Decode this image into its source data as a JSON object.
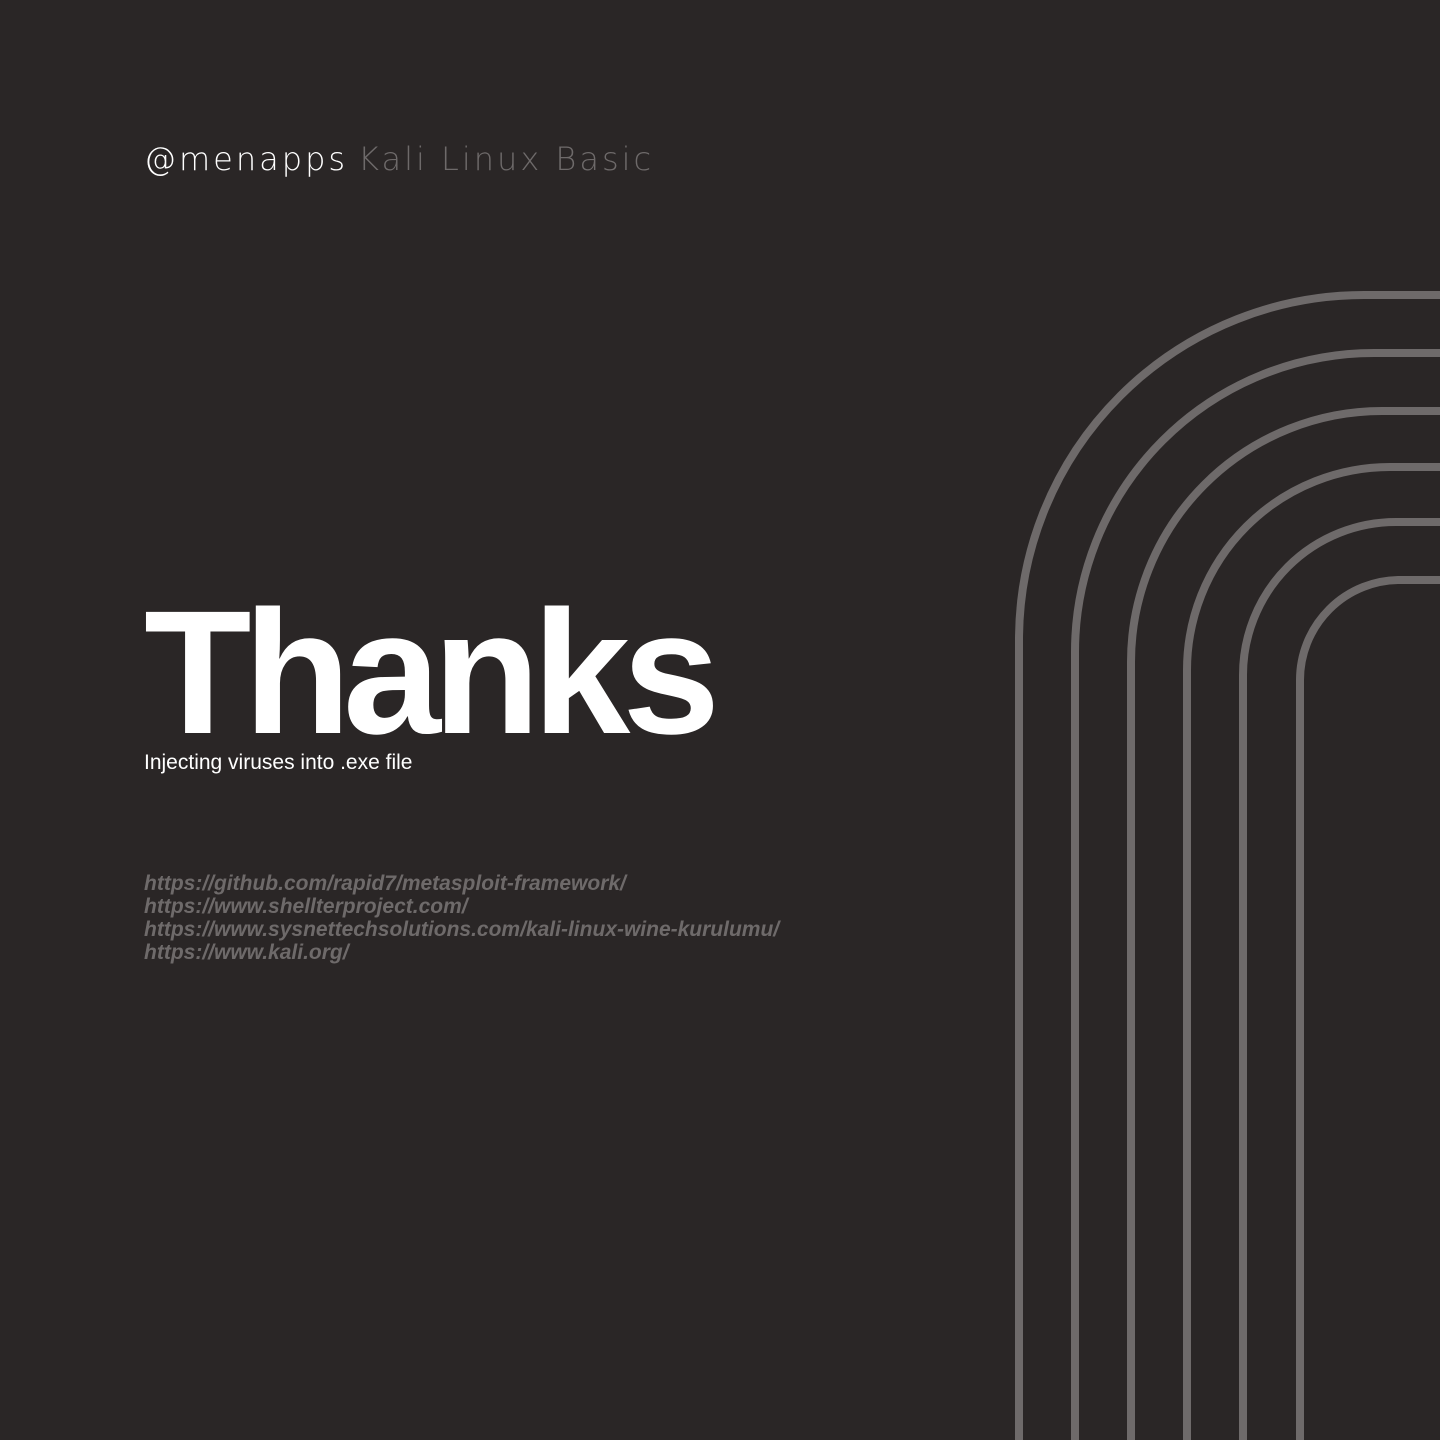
{
  "header": {
    "handle": "@menapps",
    "series": "Kali Linux Basic"
  },
  "main": {
    "title": "Thanks",
    "subtitle": "Injecting viruses into .exe file",
    "links": [
      "https://github.com/rapid7/metasploit-framework/",
      "https://www.shellterproject.com/",
      "https://www.sysnettechsolutions.com/kali-linux-wine-kurulumu/",
      "https://www.kali.org/"
    ]
  },
  "colors": {
    "background": "#2a2626",
    "primary_text": "#ffffff",
    "muted_text": "#6e6a6a",
    "arch_stroke": "#6e6a6a"
  },
  "decoration": {
    "icon": "concentric-arches-graphic"
  }
}
